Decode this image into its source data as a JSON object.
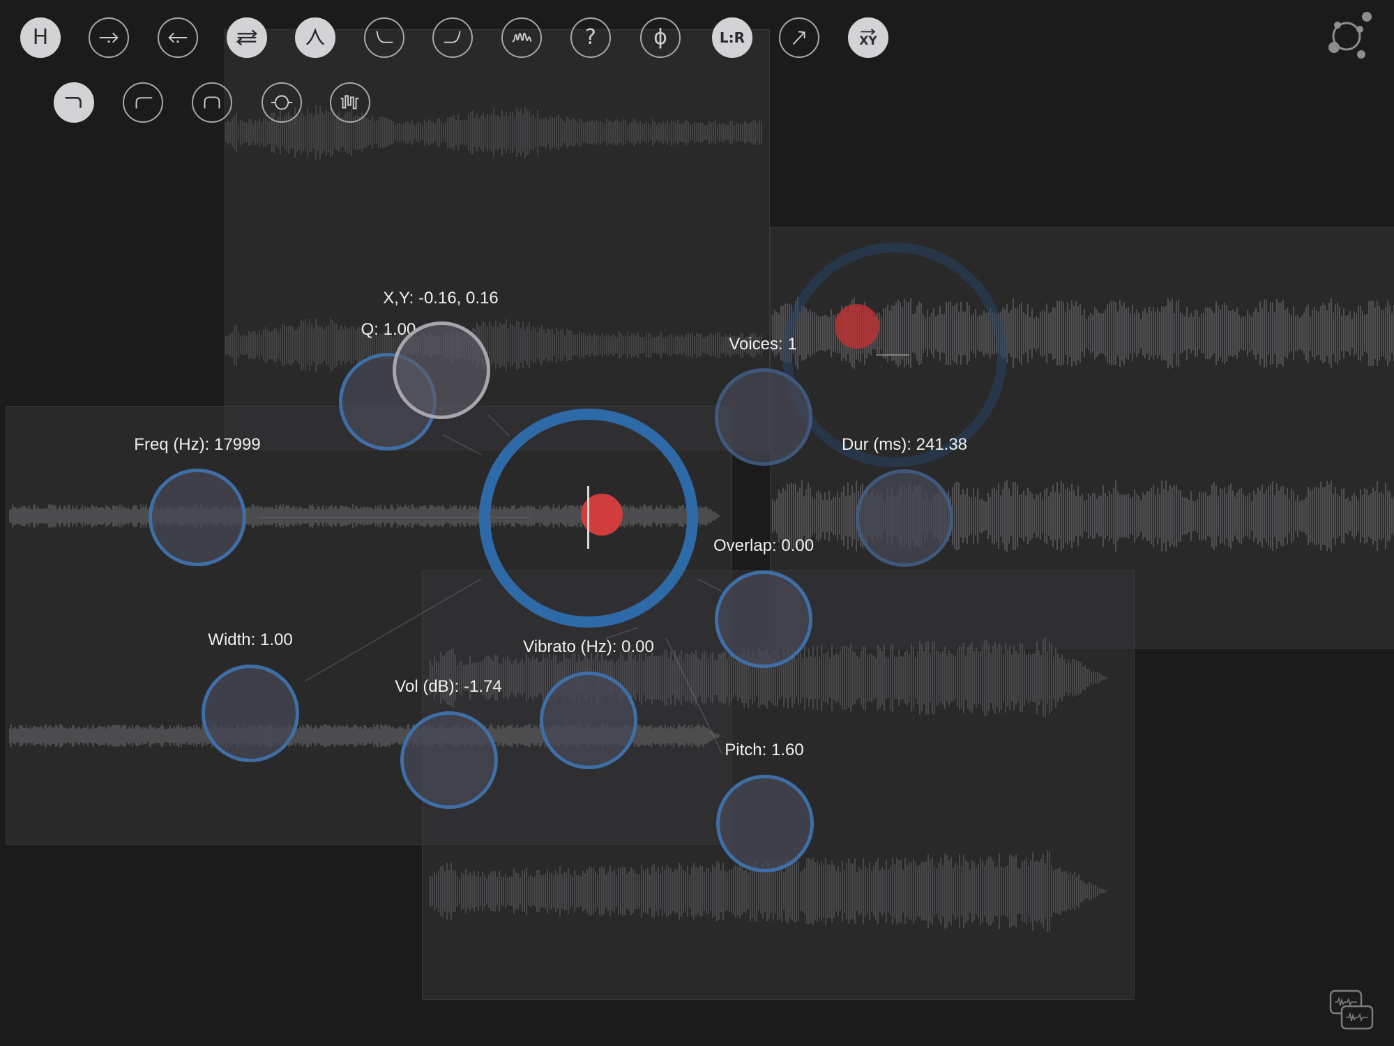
{
  "toolbar": {
    "row1": [
      {
        "name": "h-button",
        "icon": "letter-h",
        "text": "H",
        "active": true
      },
      {
        "name": "arrow-right-button",
        "icon": "arrow-right-icon",
        "text": "",
        "active": false
      },
      {
        "name": "arrow-left-button",
        "icon": "arrow-left-icon",
        "text": "",
        "active": false
      },
      {
        "name": "swap-button",
        "icon": "swap-arrows-icon",
        "text": "",
        "active": true
      },
      {
        "name": "bandpass-button",
        "icon": "bell-curve-icon",
        "text": "",
        "active": true
      },
      {
        "name": "lowshelf-button",
        "icon": "low-curve-icon",
        "text": "",
        "active": false
      },
      {
        "name": "highshelf-button",
        "icon": "high-curve-icon",
        "text": "",
        "active": false
      },
      {
        "name": "waveform-button",
        "icon": "wave-peaks-icon",
        "text": "",
        "active": false
      },
      {
        "name": "help-button",
        "icon": "question-icon",
        "text": "?",
        "active": false
      },
      {
        "name": "phase-button",
        "icon": "phi-icon",
        "text": "ϕ",
        "active": false
      },
      {
        "name": "lr-button",
        "icon": "lr-icon",
        "text": "L:R",
        "active": true
      },
      {
        "name": "diagonal-arrow-button",
        "icon": "diagonal-arrow-icon",
        "text": "",
        "active": false
      },
      {
        "name": "xy-button",
        "icon": "xy-arrow-icon",
        "text": "XY",
        "active": true
      }
    ],
    "row2": [
      {
        "name": "lowpass-filter-button",
        "icon": "lowpass-icon",
        "active": true
      },
      {
        "name": "highpass-filter-button",
        "icon": "highpass-icon",
        "active": false
      },
      {
        "name": "band-filter-button",
        "icon": "band-icon",
        "active": false
      },
      {
        "name": "notch-filter-button",
        "icon": "notch-icon",
        "active": false
      },
      {
        "name": "comb-filter-button",
        "icon": "comb-icon",
        "active": false
      }
    ]
  },
  "controls": {
    "xy": "X,Y: -0.16, 0.16",
    "q": "Q: 1.00",
    "freq": "Freq (Hz): 17999",
    "width": "Width: 1.00",
    "vol": "Vol (dB): -1.74",
    "vibrato": "Vibrato (Hz): 0.00",
    "voices": "Voices:  1",
    "dur": "Dur (ms): 241.38",
    "overlap": "Overlap: 0.00",
    "pitch": "Pitch: 1.60"
  },
  "colors": {
    "background": "#1b1b1c",
    "knob_ring": "#3f6fa6",
    "main_ring": "#2f6aa8",
    "playhead_dot": "#d13d3d",
    "active_button": "#d3d3d5"
  },
  "corner_icons": {
    "top_right": "network-nodes-icon",
    "bottom_right": "sample-cards-icon"
  }
}
